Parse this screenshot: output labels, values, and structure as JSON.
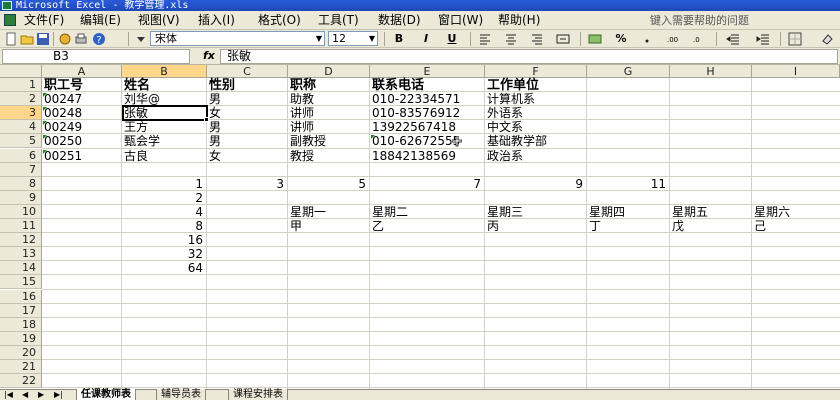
{
  "window": {
    "title": "Microsoft Excel - 教学管理.xls"
  },
  "menu": {
    "items": [
      "文件(F)",
      "编辑(E)",
      "视图(V)",
      "插入(I)",
      "格式(O)",
      "工具(T)",
      "数据(D)",
      "窗口(W)",
      "帮助(H)"
    ],
    "help_placeholder": "键入需要帮助的问题"
  },
  "toolbar": {
    "font": "宋体",
    "size": "12",
    "bold_label": "B",
    "italic_label": "I",
    "underline_label": "U",
    "percent_label": "%"
  },
  "formula_bar": {
    "name_box": "B3",
    "fx_label": "fx",
    "content": "张敏"
  },
  "grid": {
    "columns": [
      "A",
      "B",
      "C",
      "D",
      "E",
      "F",
      "G",
      "H",
      "I"
    ],
    "rows": [
      "1",
      "2",
      "3",
      "4",
      "5",
      "6",
      "7",
      "8",
      "9",
      "10",
      "11",
      "12",
      "13",
      "14",
      "15",
      "16",
      "17",
      "18",
      "19",
      "20",
      "21",
      "22"
    ],
    "selected_cell": "B3",
    "header_row": [
      "职工号",
      "姓名",
      "性别",
      "职称",
      "联系电话",
      "工作单位"
    ],
    "records": [
      [
        "00247",
        "刘华@",
        "男",
        "助教",
        "010-22334571",
        "计算机系"
      ],
      [
        "00248",
        "张敏",
        "女",
        "讲师",
        "010-83576912",
        "外语系"
      ],
      [
        "00249",
        "王方",
        "男",
        "讲师",
        "13922567418",
        "中文系"
      ],
      [
        "00250",
        "甄会学",
        "男",
        "副教授",
        "010-62672555",
        "基础教学部"
      ],
      [
        "00251",
        "古良",
        "女",
        "教授",
        "18842138569",
        "政治系"
      ]
    ],
    "row8": [
      "1",
      "3",
      "5",
      "7",
      "9",
      "11"
    ],
    "col_b_powers": [
      "2",
      "4",
      "8",
      "16",
      "32",
      "64"
    ],
    "weekdays": [
      "星期一",
      "星期二",
      "星期三",
      "星期四",
      "星期五",
      "星期六"
    ],
    "stems": [
      "甲",
      "乙",
      "丙",
      "丁",
      "戊",
      "己"
    ]
  },
  "sheets": [
    "任课教师表",
    "辅导员表",
    "课程安排表"
  ]
}
